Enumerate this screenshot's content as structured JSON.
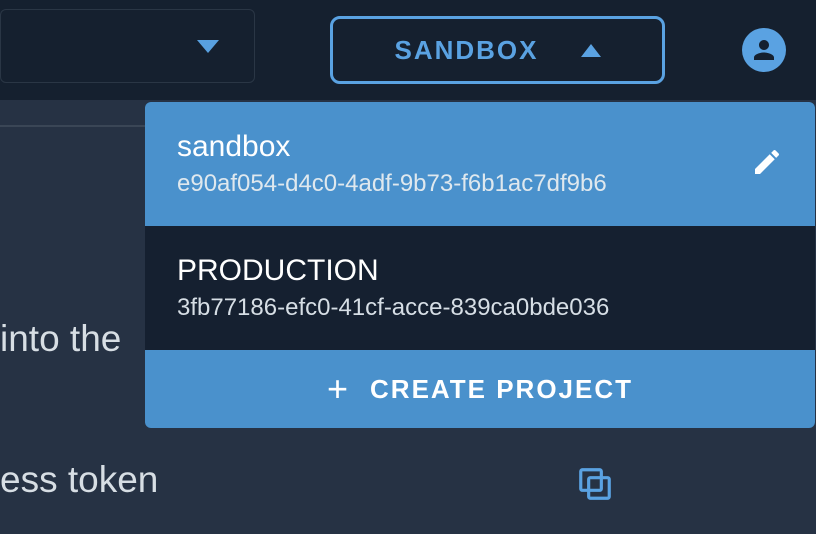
{
  "topbar": {
    "sandbox_label": "SANDBOX"
  },
  "dropdown": {
    "items": [
      {
        "name": "sandbox",
        "uuid": "e90af054-d4c0-4adf-9b73-f6b1ac7df9b6",
        "selected": true
      },
      {
        "name": "PRODUCTION",
        "uuid": "3fb77186-efc0-41cf-acce-839ca0bde036",
        "selected": false
      }
    ],
    "create_label": "CREATE PROJECT"
  },
  "background": {
    "text1": "into the",
    "text2": "ess token"
  }
}
